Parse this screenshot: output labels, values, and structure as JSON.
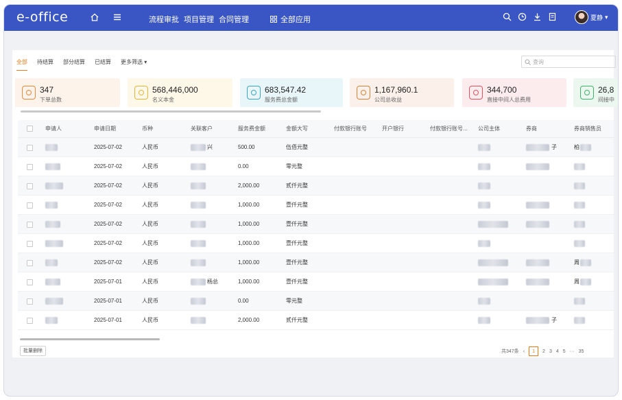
{
  "app": {
    "logo": "e-office",
    "user_name": "夏静"
  },
  "nav": {
    "items": [
      "流程审批",
      "项目管理",
      "合同管理"
    ],
    "all_apps": "全部应用"
  },
  "filters": {
    "tabs": [
      "全部",
      "待结算",
      "部分结算",
      "已结算",
      "更多筛选"
    ],
    "active_tab": 0,
    "search_placeholder": "查询"
  },
  "summary_cards": [
    {
      "value": "347",
      "label": "下单总数",
      "color": "#e8893b",
      "bg": "#fdf3ea"
    },
    {
      "value": "568,446,000",
      "label": "名义本金",
      "color": "#e7b43b",
      "bg": "#fef8e9"
    },
    {
      "value": "683,547.42",
      "label": "服务费总金额",
      "color": "#3aa6c4",
      "bg": "#e9f6f9"
    },
    {
      "value": "1,167,960.1",
      "label": "公司总收益",
      "color": "#d9823a",
      "bg": "#fbf1ea"
    },
    {
      "value": "344,700",
      "label": "直接中间人总费用",
      "color": "#e2505f",
      "bg": "#fcecee"
    },
    {
      "value": "26,8",
      "label": "间接中",
      "color": "#3fb36a",
      "bg": "#ebf7ef"
    }
  ],
  "table": {
    "columns": [
      "申请人",
      "申请日期",
      "币种",
      "关联客户",
      "服务费金额",
      "金额大写",
      "付款银行账号",
      "开户银行",
      "付款银行账号...",
      "公司主体",
      "券商",
      "券商销售员"
    ],
    "rows": [
      {
        "date": "2025-07-02",
        "currency": "人民币",
        "customer_tail": "兴",
        "amount": "500.00",
        "amount_words": "伍佰元整",
        "broker_tail": "子",
        "sales_tail": "柏"
      },
      {
        "date": "2025-07-02",
        "currency": "人民币",
        "customer_tail": "",
        "amount": "0.00",
        "amount_words": "零元整",
        "broker_tail": "",
        "sales_tail": ""
      },
      {
        "date": "2025-07-02",
        "currency": "人民币",
        "customer_tail": "",
        "amount": "2,000.00",
        "amount_words": "贰仟元整",
        "broker_tail": "",
        "sales_tail": ""
      },
      {
        "date": "2025-07-02",
        "currency": "人民币",
        "customer_tail": "",
        "amount": "1,000.00",
        "amount_words": "壹仟元整",
        "broker_tail": "",
        "sales_tail": ""
      },
      {
        "date": "2025-07-02",
        "currency": "人民币",
        "customer_tail": "",
        "amount": "1,000.00",
        "amount_words": "壹仟元整",
        "broker_tail": "",
        "sales_tail": ""
      },
      {
        "date": "2025-07-02",
        "currency": "人民币",
        "customer_tail": "",
        "amount": "1,000.00",
        "amount_words": "壹仟元整",
        "broker_tail": "",
        "sales_tail": ""
      },
      {
        "date": "2025-07-02",
        "currency": "人民币",
        "customer_tail": "",
        "amount": "1,000.00",
        "amount_words": "壹仟元整",
        "broker_tail": "",
        "sales_tail": "周"
      },
      {
        "date": "2025-07-01",
        "currency": "人民币",
        "customer_tail": "杨总",
        "amount": "1,000.00",
        "amount_words": "壹仟元整",
        "broker_tail": "",
        "sales_tail": "周"
      },
      {
        "date": "2025-07-01",
        "currency": "人民币",
        "customer_tail": "",
        "amount": "0.00",
        "amount_words": "零元整",
        "broker_tail": "",
        "sales_tail": ""
      },
      {
        "date": "2025-07-01",
        "currency": "人民币",
        "customer_tail": "",
        "amount": "2,000.00",
        "amount_words": "贰仟元整",
        "broker_tail": "子",
        "sales_tail": ""
      }
    ]
  },
  "footer": {
    "batch_delete": "批量删除",
    "total": "共347条",
    "pages": [
      "1",
      "2",
      "3",
      "4",
      "5",
      "···",
      "35"
    ],
    "current_page": "1"
  }
}
